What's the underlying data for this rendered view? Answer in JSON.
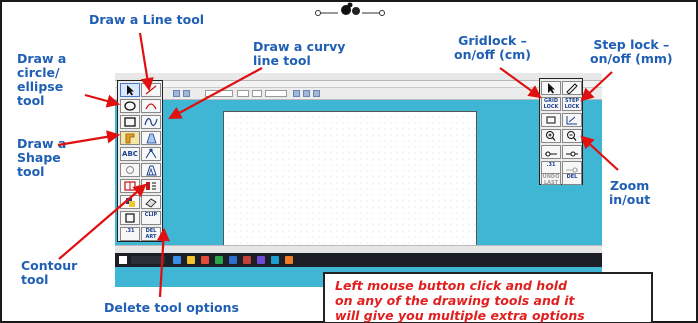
{
  "labels": {
    "line_tool": "Draw a Line tool",
    "curvy_tool": "Draw a curvy\nline tool",
    "circle_tool": "Draw a\ncircle/\nellipse\ntool",
    "shape_tool": "Draw a\nShape\ntool",
    "gridlock": "Gridlock –\non/off (cm)",
    "steplock": "Step lock –\non/off (mm)",
    "zoom": "Zoom\nin/out",
    "contour": "Contour\ntool",
    "delete": "Delete tool options"
  },
  "info_box": {
    "text": "Left mouse button click and hold\non any of the drawing tools and it\nwill give you multiple extra options"
  },
  "left_palette": {
    "abc": "ABC",
    "clip": "CLIP",
    "del_art": "DEL\nART",
    "size_31": ".31"
  },
  "right_palette": {
    "grid_lock": "GRID\nLOCK",
    "step_lock": "STEP\nLOCK",
    "undo_last": "UNDO\nLAST",
    "del": "DEL",
    "small_31": ".31"
  },
  "colors": {
    "label_blue": "#1f5fb4",
    "arrow_red": "#e01010",
    "info_red": "#e02020",
    "desktop": "#3fb6d4"
  },
  "icons": {
    "arrows": "red-callout-arrows"
  }
}
